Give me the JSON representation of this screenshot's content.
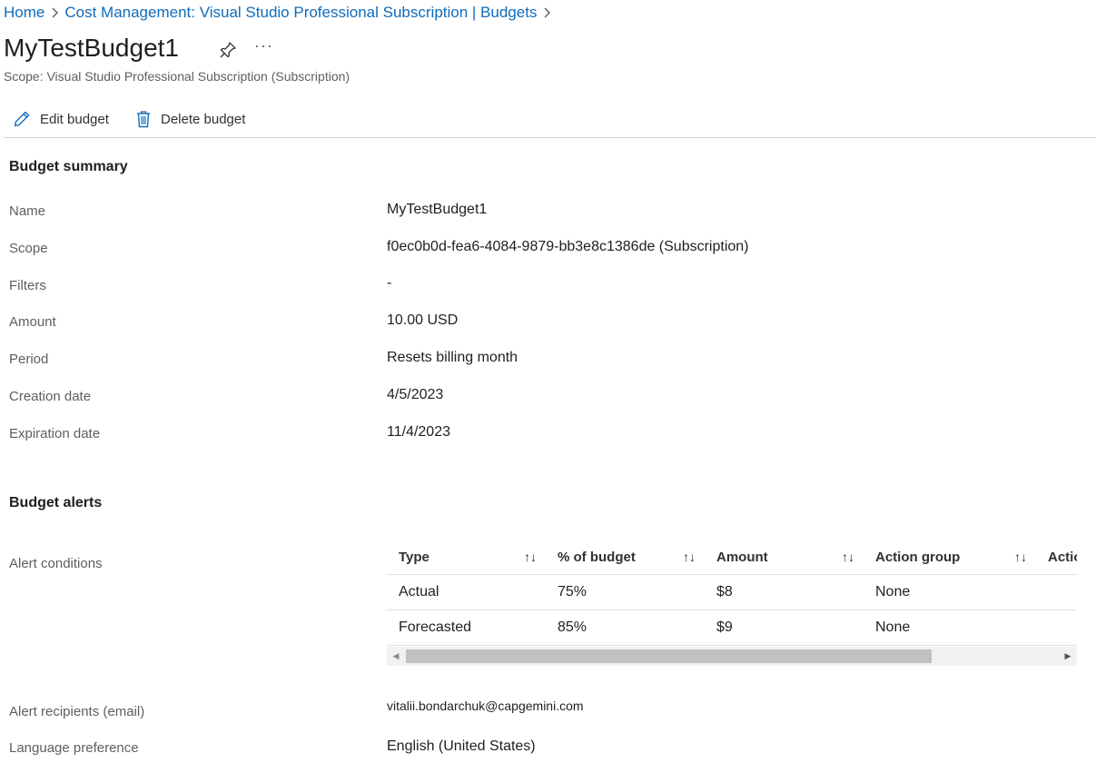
{
  "breadcrumb": {
    "items": [
      "Home",
      "Cost Management: Visual Studio Professional Subscription | Budgets"
    ]
  },
  "header": {
    "title": "MyTestBudget1",
    "more_label": "···",
    "subtitle": "Scope: Visual Studio Professional Subscription (Subscription)"
  },
  "toolbar": {
    "edit_label": "Edit budget",
    "delete_label": "Delete budget"
  },
  "summary": {
    "heading": "Budget summary",
    "fields": [
      {
        "label": "Name",
        "value": "MyTestBudget1"
      },
      {
        "label": "Scope",
        "value": "f0ec0b0d-fea6-4084-9879-bb3e8c1386de (Subscription)"
      },
      {
        "label": "Filters",
        "value": "-"
      },
      {
        "label": "Amount",
        "value": "10.00 USD"
      },
      {
        "label": "Period",
        "value": "Resets billing month"
      },
      {
        "label": "Creation date",
        "value": "4/5/2023"
      },
      {
        "label": "Expiration date",
        "value": "11/4/2023"
      }
    ]
  },
  "alerts": {
    "heading": "Budget alerts",
    "conditions_label": "Alert conditions",
    "sort_icon": "↑↓",
    "columns": [
      "Type",
      "% of budget",
      "Amount",
      "Action group",
      "Action group type"
    ],
    "rows": [
      [
        "Actual",
        "75%",
        "$8",
        "None",
        ""
      ],
      [
        "Forecasted",
        "85%",
        "$9",
        "None",
        ""
      ]
    ],
    "recipients_label": "Alert recipients (email)",
    "recipients_value": "vitalii.bondarchuk@capgemini.com",
    "language_label": "Language preference",
    "language_value": "English (United States)"
  },
  "icons": {
    "pin": "pin-icon",
    "edit": "pencil-icon",
    "delete": "trash-icon",
    "chevron": "chevron-right-icon",
    "sort": "sort-arrows-icon"
  },
  "colors": {
    "link": "#0f6cbd",
    "toolbar_icon": "#0f6cbd",
    "text": "#323130",
    "muted": "#605e5c"
  }
}
